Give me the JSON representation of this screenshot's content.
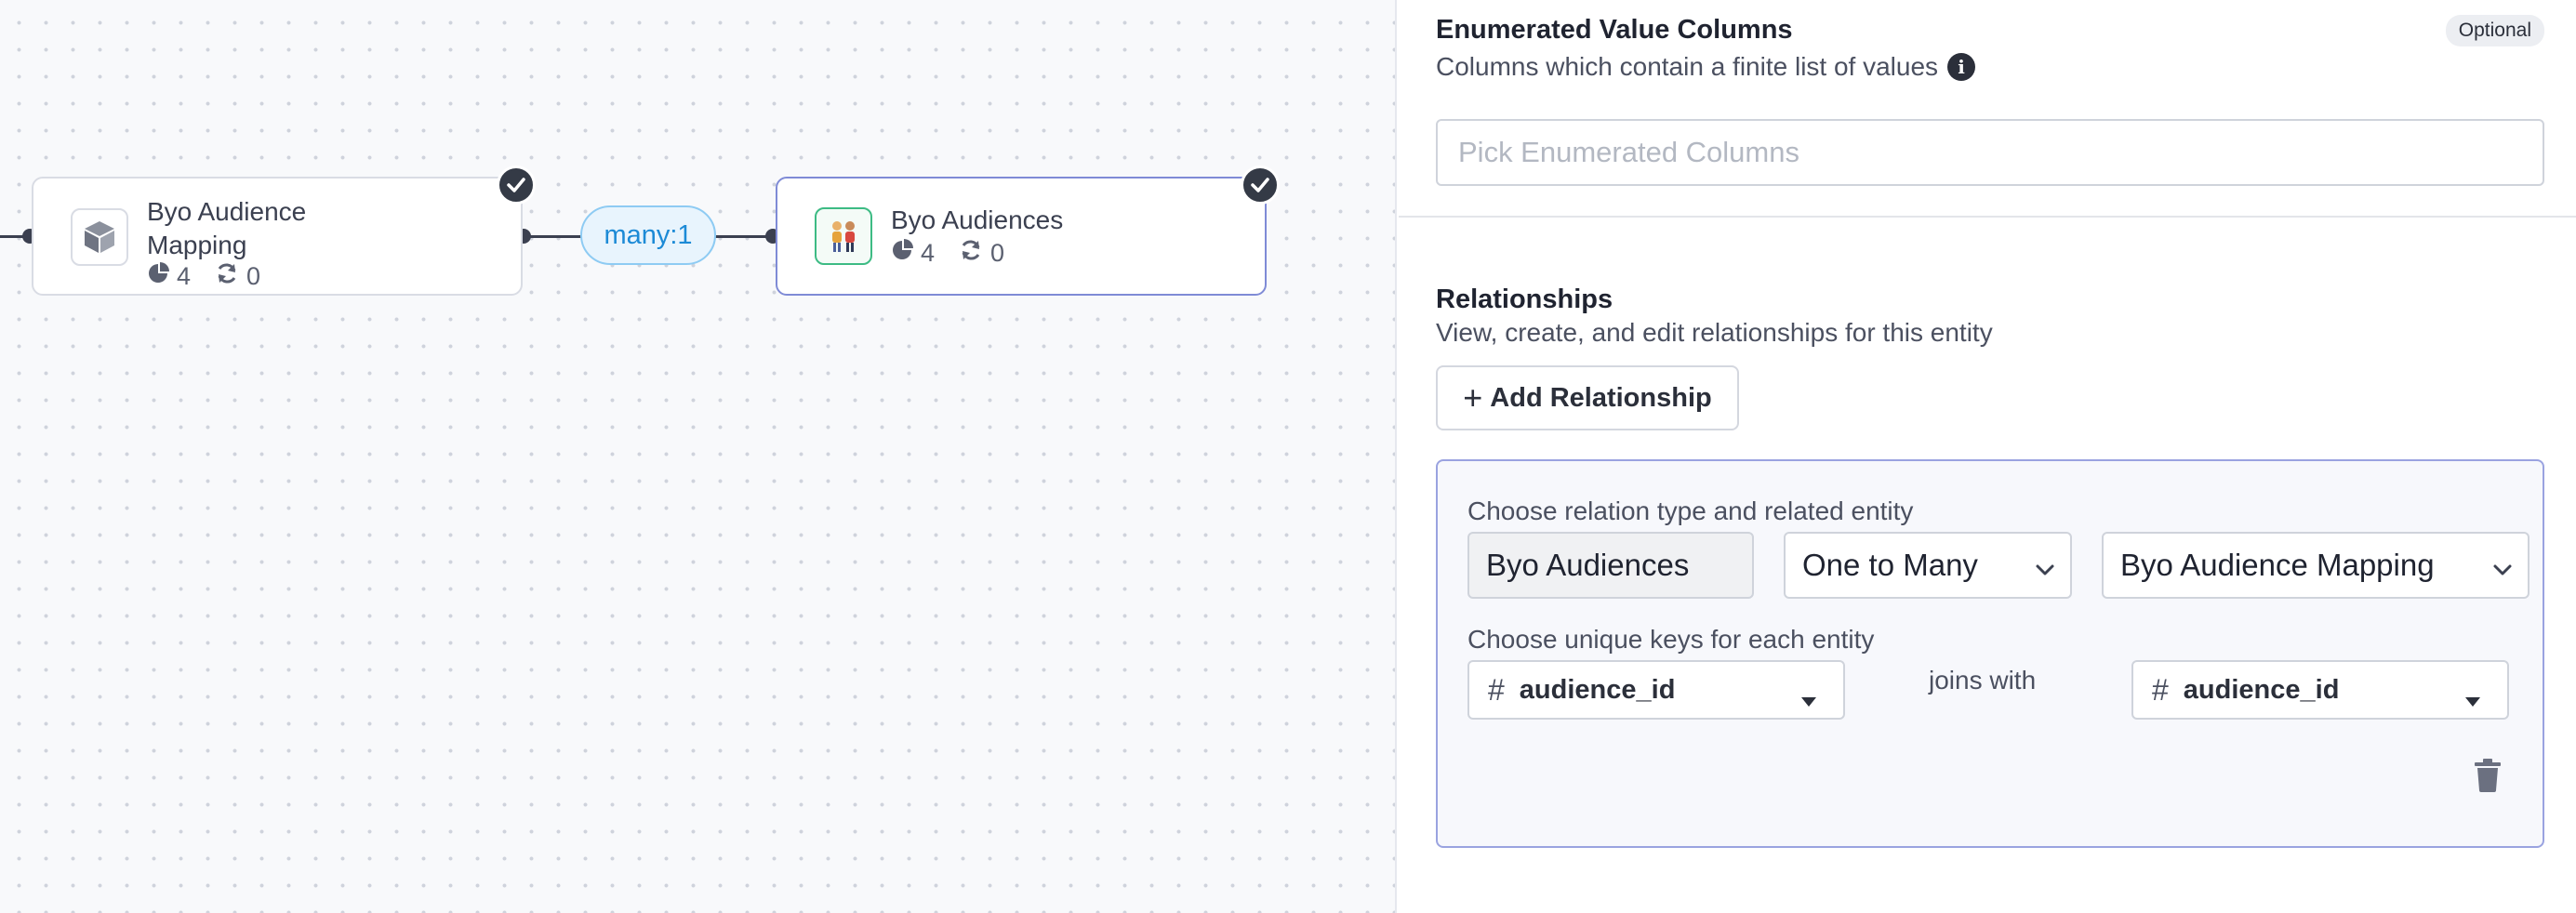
{
  "graph": {
    "relationship_label": "many:1",
    "nodes": [
      {
        "title_line1": "Byo Audience",
        "title_line2": "Mapping",
        "columns_count": "4",
        "sync_count": "0",
        "icon": "cube-icon",
        "checked": true
      },
      {
        "title": "Byo Audiences",
        "columns_count": "4",
        "sync_count": "0",
        "icon": "people-icon",
        "checked": true,
        "selected": true
      }
    ]
  },
  "panel": {
    "enumerated": {
      "title": "Enumerated Value Columns",
      "badge": "Optional",
      "subtitle": "Columns which contain a finite list of values",
      "placeholder": "Pick Enumerated Columns"
    },
    "relationships": {
      "title": "Relationships",
      "subtitle": "View, create, and edit relationships for this entity",
      "add_button": "Add Relationship",
      "card": {
        "type_label": "Choose relation type and related entity",
        "source_entity": "Byo Audiences",
        "relation_type": "One to Many",
        "related_entity": "Byo Audience Mapping",
        "keys_label": "Choose unique keys for each entity",
        "source_key": "audience_id",
        "joins_text": "joins with",
        "target_key": "audience_id"
      }
    }
  },
  "colors": {
    "accent_blue": "#1c8ad6",
    "selected_border": "#7f8bd6",
    "dark_badge": "#343a46",
    "green_icon_border": "#3dbb84"
  }
}
